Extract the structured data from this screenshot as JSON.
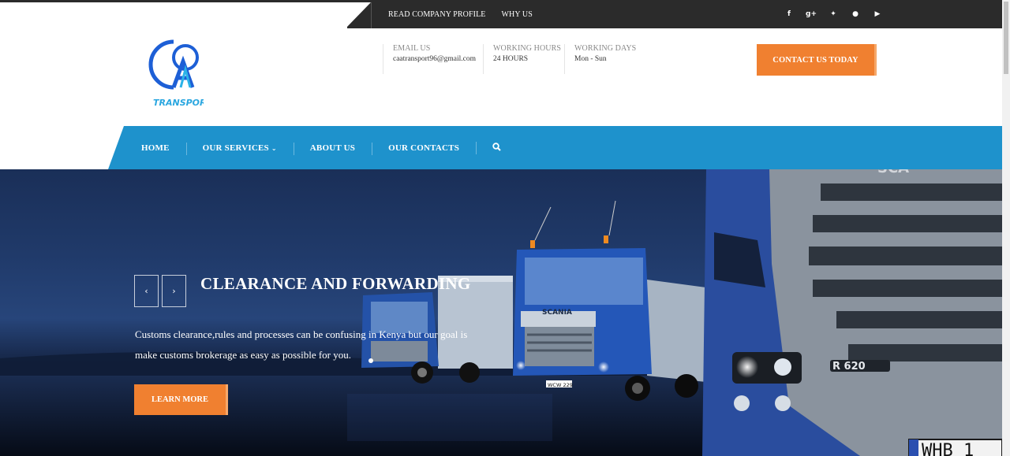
{
  "topbar": {
    "links": [
      "READ COMPANY PROFILE",
      "WHY US"
    ],
    "socials": [
      {
        "icon": "facebook-icon",
        "glyph": "f"
      },
      {
        "icon": "google-plus-icon",
        "glyph": "g+"
      },
      {
        "icon": "twitter-icon",
        "glyph": "✦"
      },
      {
        "icon": "pinterest-icon",
        "glyph": "●"
      },
      {
        "icon": "youtube-icon",
        "glyph": "▶"
      }
    ]
  },
  "logo": {
    "text": "TRANSPORT"
  },
  "header": {
    "email_label": "EMAIL US",
    "email_value": "caatransport96@gmail.com",
    "hours_label": "WORKING HOURS",
    "hours_value": "24 HOURS",
    "days_label": "WORKING DAYS",
    "days_value": "Mon - Sun",
    "contact_button": "CONTACT US TODAY"
  },
  "nav": {
    "items": [
      "HOME",
      "OUR SERVICES",
      "ABOUT US",
      "OUR CONTACTS"
    ]
  },
  "hero": {
    "prev_glyph": "‹",
    "next_glyph": "›",
    "title": "CLEARANCE AND FORWARDING",
    "text": "Customs clearance,rules and processes can be confusing in Kenya but our goal is make customs brokerage as easy as possible for you.",
    "button": "LEARN MORE",
    "truck_brand": "SCANIA",
    "truck_model": "R 620",
    "plate_front": "WHB 1",
    "plate_mid": "WCW 229"
  },
  "colors": {
    "accent": "#f08030",
    "nav": "#1e92cc",
    "topbar": "#2b2b2b",
    "logo_blue": "#1d5fd6"
  }
}
